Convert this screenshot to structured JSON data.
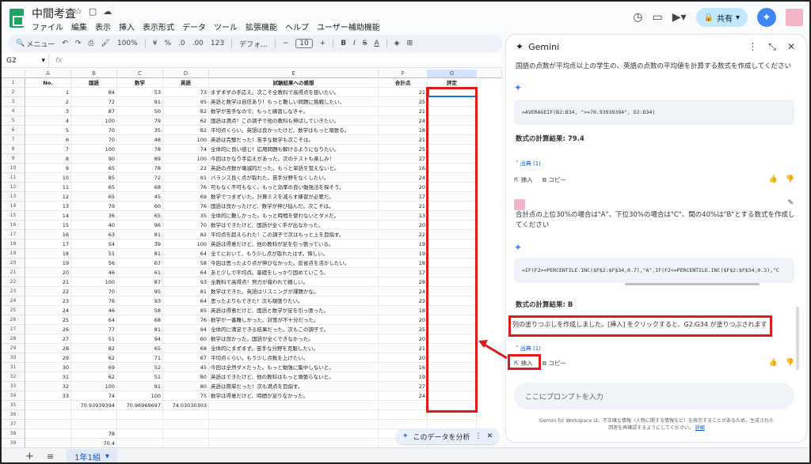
{
  "app": {
    "doc_title": "中間考査",
    "menus": [
      "ファイル",
      "編集",
      "表示",
      "挿入",
      "表示形式",
      "データ",
      "ツール",
      "拡張機能",
      "ヘルプ",
      "ユーザー補助機能"
    ],
    "share_label": "共有"
  },
  "toolbar": {
    "search_label": "メニュー",
    "zoom": "100%",
    "currency": "¥",
    "percent": "%",
    "dec_down": ".0",
    "dec_up": ".00",
    "num_format": "123",
    "font": "デフォ...",
    "font_size": "10",
    "bold": "B",
    "italic": "I",
    "strike": "S",
    "text_color": "A"
  },
  "formula_bar": {
    "cell_ref": "G2",
    "fx": "fx",
    "value": ""
  },
  "grid": {
    "columns": [
      "A",
      "B",
      "C",
      "D",
      "E",
      "F",
      "G"
    ],
    "headers": {
      "a": "No.",
      "b": "国語",
      "c": "数学",
      "d": "英語",
      "e": "試験結果への感想",
      "f": "合計点",
      "g": "評定"
    },
    "rows": [
      {
        "n": "1",
        "a": "1",
        "b": "84",
        "c": "53",
        "d": "73",
        "e": "まずまずの手応え。次こそ全教科で高得点を狙いたい。",
        "f": "21"
      },
      {
        "n": "2",
        "a": "2",
        "b": "72",
        "c": "91",
        "d": "95",
        "e": "英語と数学は自信あり！もっと難しい問題に挑戦したい。",
        "f": "25"
      },
      {
        "n": "3",
        "a": "3",
        "b": "87",
        "c": "50",
        "d": "82",
        "e": "数学が苦手なので、もっと練習しなきゃ。",
        "f": "21"
      },
      {
        "n": "4",
        "a": "4",
        "b": "100",
        "c": "79",
        "d": "62",
        "e": "国語は満点！この調子で他の教科も伸ばしていきたい。",
        "f": "24"
      },
      {
        "n": "5",
        "a": "5",
        "b": "70",
        "c": "35",
        "d": "82",
        "e": "平均点くらい。英語は良かったけど、数学はもっと頑張る。",
        "f": "18"
      },
      {
        "n": "6",
        "a": "6",
        "b": "70",
        "c": "48",
        "d": "100",
        "e": "英語は完璧だった！苦手な数学も次こそは。",
        "f": "21"
      },
      {
        "n": "7",
        "a": "7",
        "b": "100",
        "c": "78",
        "d": "74",
        "e": "全体的に良い感じ！応用問題も解けるようになりたい。",
        "f": "25"
      },
      {
        "n": "8",
        "a": "8",
        "b": "90",
        "c": "89",
        "d": "100",
        "e": "今回はかなり手応えがあった。次のテストも楽しみ！",
        "f": "27"
      },
      {
        "n": "9",
        "a": "9",
        "b": "65",
        "c": "78",
        "d": "22",
        "e": "英語の点数が壊滅的だった。もっと単語を覚えないと。",
        "f": "16"
      },
      {
        "n": "10",
        "a": "10",
        "b": "85",
        "c": "72",
        "d": "91",
        "e": "バランス良く点が取れた。苦手分野をなくしたい。",
        "f": "24"
      },
      {
        "n": "11",
        "a": "11",
        "b": "65",
        "c": "68",
        "d": "76",
        "e": "可もなく不可もなく。もっと効率の良い勉強法を探そう。",
        "f": "20"
      },
      {
        "n": "12",
        "a": "12",
        "b": "65",
        "c": "45",
        "d": "69",
        "e": "数学でつまずいた。計算ミスを減らす練習が必要だ。",
        "f": "17"
      },
      {
        "n": "13",
        "a": "13",
        "b": "79",
        "c": "60",
        "d": "76",
        "e": "国語は良かったけど、数学が伸び悩んだ。次こそは。",
        "f": "21"
      },
      {
        "n": "14",
        "a": "14",
        "b": "36",
        "c": "65",
        "d": "35",
        "e": "全体的に難しかった。もっと時間を使わないとダメだ。",
        "f": "13"
      },
      {
        "n": "15",
        "a": "15",
        "b": "40",
        "c": "96",
        "d": "70",
        "e": "数学はできたけど、国語が全く手が出なかった。",
        "f": "20"
      },
      {
        "n": "16",
        "a": "16",
        "b": "63",
        "c": "81",
        "d": "82",
        "e": "平均点を超えられた！この調子で次はもっと上を目指す。",
        "f": "22"
      },
      {
        "n": "17",
        "a": "17",
        "b": "54",
        "c": "39",
        "d": "100",
        "e": "英語は得意だけど、他の教科が足を引っ張っている。",
        "f": "19"
      },
      {
        "n": "18",
        "a": "18",
        "b": "51",
        "c": "81",
        "d": "64",
        "e": "全てにおいて、もう少し点が取れたはず。悔しい。",
        "f": "19"
      },
      {
        "n": "19",
        "a": "19",
        "b": "56",
        "c": "67",
        "d": "58",
        "e": "今回は思ったより点が伸びなかった。反省点を活かしたい。",
        "f": "18"
      },
      {
        "n": "20",
        "a": "20",
        "b": "46",
        "c": "61",
        "d": "64",
        "e": "あと少しで平均点。基礎をしっかり固めていこう。",
        "f": "17"
      },
      {
        "n": "21",
        "a": "21",
        "b": "100",
        "c": "87",
        "d": "93",
        "e": "全教科で高得点！努力が報われて嬉しい。",
        "f": "28"
      },
      {
        "n": "22",
        "a": "22",
        "b": "70",
        "c": "95",
        "d": "81",
        "e": "数学はできた。英語はリスニングが課題かな。",
        "f": "24"
      },
      {
        "n": "23",
        "a": "23",
        "b": "76",
        "c": "93",
        "d": "64",
        "e": "思ったよりもできた！次も頑張りたい。",
        "f": "23"
      },
      {
        "n": "24",
        "a": "24",
        "b": "46",
        "c": "58",
        "d": "85",
        "e": "英語は得意だけど、国語と数学が足を引っ張った。",
        "f": "18"
      },
      {
        "n": "25",
        "a": "25",
        "b": "64",
        "c": "68",
        "d": "76",
        "e": "数学が一番難しかった。対策が不十分だった。",
        "f": "20"
      },
      {
        "n": "26",
        "a": "26",
        "b": "77",
        "c": "81",
        "d": "94",
        "e": "全体的に満足できる結果だった。次もこの調子で。",
        "f": "25"
      },
      {
        "n": "27",
        "a": "27",
        "b": "51",
        "c": "94",
        "d": "60",
        "e": "数学は良かった。国語が全くできなかった。",
        "f": "20"
      },
      {
        "n": "28",
        "a": "28",
        "b": "82",
        "c": "65",
        "d": "68",
        "e": "全体的にまずまず。苦手な分野を克服したい。",
        "f": "21"
      },
      {
        "n": "29",
        "a": "29",
        "b": "62",
        "c": "71",
        "d": "67",
        "e": "平均点くらい。もう少し点数を上げたい。",
        "f": "20"
      },
      {
        "n": "30",
        "a": "30",
        "b": "69",
        "c": "52",
        "d": "45",
        "e": "今回は全然ダメだった。もっと勉強に集中しないと。",
        "f": "16"
      },
      {
        "n": "31",
        "a": "31",
        "b": "62",
        "c": "51",
        "d": "80",
        "e": "英語はできたけど、他の教科はもっと頑張らないと。",
        "f": "19"
      },
      {
        "n": "32",
        "a": "32",
        "b": "100",
        "c": "91",
        "d": "80",
        "e": "英語は簡単だった！次も満点を目指す。",
        "f": "27"
      },
      {
        "n": "33",
        "a": "33",
        "b": "74",
        "c": "100",
        "d": "75",
        "e": "数学は得意だけど、時間が足りなかった。",
        "f": "24"
      }
    ],
    "averages": {
      "n": "34",
      "b": "70.93939394",
      "c": "70.96969697",
      "d": "74.03030303"
    },
    "extra_rows": [
      {
        "n": "35",
        "b": ""
      },
      {
        "n": "36",
        "b": ""
      },
      {
        "n": "37",
        "b": "78"
      },
      {
        "n": "38",
        "b": "70.4"
      }
    ]
  },
  "explore": {
    "label": "このデータを分析"
  },
  "sheets": {
    "active": "1年1組"
  },
  "gemini": {
    "title": "Gemini",
    "q1": "国語の点数が平均点以上の学生の、英語の点数の平均値を計算する数式を作成してください",
    "formula1": "=AVERAGEIF(B2:B34, \">=70.93939394\", D2:D34)",
    "result1": "数式の計算結果: 79.4",
    "source1": "出典 (1)",
    "insert": "挿入",
    "copy": "コピー",
    "q2": "合計点の上位30%の場合は\"A\"、下位30%の場合は\"C\"、間の40%は\"B\"とする数式を作成してください",
    "formula2": "=IF(F2>=PERCENTILE.INC($F$2:$F$34,0.7),\"A\",IF(F2<=PERCENTILE.INC($F$2:$F$34,0.3),\"C",
    "result2": "数式の計算結果: B",
    "message": "列の塗りつぶしを作成しました。[挿入] をクリックすると、G2:G34 が塗りつぶされます",
    "source2": "出典 (1)",
    "prompt_placeholder": "ここにプロンプトを入力",
    "disclaimer": "Gemini for Workspace は、不正確な情報（人物に関する情報など）を表示することがあるため、生成された回答を再確認するようにしてください。",
    "disclaimer_link": "詳細"
  },
  "colors": {
    "accent": "#0b57d0",
    "annotation_red": "#e01b1b",
    "gemini_blue": "#4285f4"
  }
}
